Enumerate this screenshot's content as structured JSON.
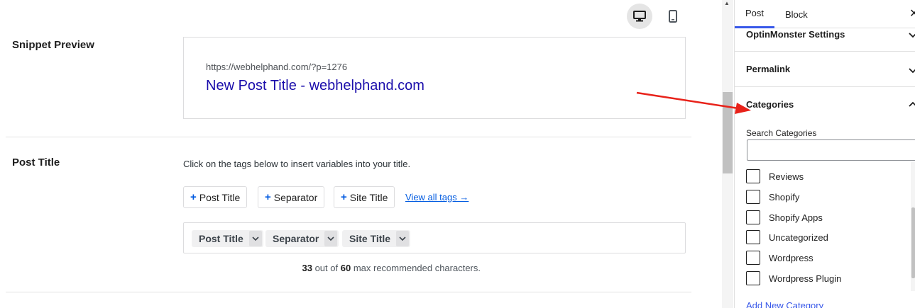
{
  "editor": {
    "device_icons": [
      "desktop-icon",
      "mobile-icon"
    ],
    "snippet_preview": {
      "label": "Snippet Preview",
      "url": "https://webhelphand.com/?p=1276",
      "title": "New Post Title - webhelphand.com"
    },
    "post_title": {
      "label": "Post Title",
      "hint": "Click on the tags below to insert variables into your title.",
      "tag_buttons": [
        "Post Title",
        "Separator",
        "Site Title"
      ],
      "view_all_tags": "View all tags →",
      "chips": [
        "Post Title",
        "Separator",
        "Site Title"
      ],
      "char_count": "33",
      "char_count_max": "60",
      "char_count_text": "max recommended characters.",
      "char_count_mid": "out of"
    }
  },
  "sidebar": {
    "tabs": [
      "Post",
      "Block"
    ],
    "active_tab": "Post",
    "panels": [
      {
        "title": "OptinMonster Settings",
        "state": "collapsed"
      },
      {
        "title": "Permalink",
        "state": "collapsed"
      },
      {
        "title": "Categories",
        "state": "expanded"
      }
    ],
    "categories": {
      "search_label": "Search Categories",
      "search_value": "",
      "items": [
        {
          "label": "Reviews",
          "checked": false
        },
        {
          "label": "Shopify",
          "checked": false
        },
        {
          "label": "Shopify Apps",
          "checked": false
        },
        {
          "label": "Uncategorized",
          "checked": false
        },
        {
          "label": "Wordpress",
          "checked": false
        },
        {
          "label": "Wordpress Plugin",
          "checked": false
        }
      ],
      "add_new": "Add New Category"
    }
  },
  "colors": {
    "accent": "#3858e9",
    "link": "#005ae0",
    "snippet_title": "#1a0dab",
    "annotation_arrow": "#e8221a"
  }
}
